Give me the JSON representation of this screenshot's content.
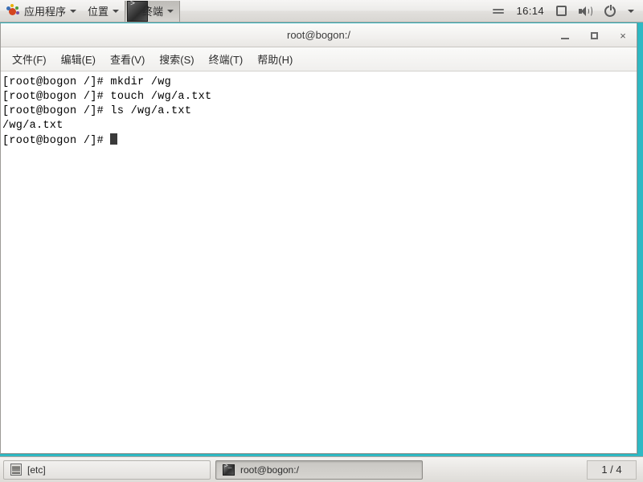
{
  "top_panel": {
    "logo_icon": "gnome-foot-icon",
    "menus": [
      {
        "label": "应用程序",
        "icon": "gnome-foot-icon",
        "active": false
      },
      {
        "label": "位置",
        "active": false
      },
      {
        "label": "终端",
        "active": true,
        "icon": "terminal-icon"
      }
    ],
    "tray": {
      "lines_icon": "menu-lines-icon",
      "clock": "16:14",
      "screen_icon": "display-icon",
      "volume_icon": "volume-icon",
      "power_icon": "power-icon",
      "dropdown_icon": "chevron-down-icon"
    }
  },
  "window": {
    "title": "root@bogon:/",
    "buttons": {
      "minimize": "minimize-button",
      "maximize": "maximize-button",
      "close": "×"
    },
    "menubar": [
      {
        "label": "文件(F)"
      },
      {
        "label": "编辑(E)"
      },
      {
        "label": "查看(V)"
      },
      {
        "label": "搜索(S)"
      },
      {
        "label": "终端(T)"
      },
      {
        "label": "帮助(H)"
      }
    ]
  },
  "terminal": {
    "background": "#ffffff",
    "foreground": "#000000",
    "cursor_color": "#3a3a3a",
    "lines": [
      "[root@bogon /]# mkdir /wg",
      "[root@bogon /]# touch /wg/a.txt",
      "[root@bogon /]# ls /wg/a.txt",
      "/wg/a.txt"
    ],
    "prompt": "[root@bogon /]# "
  },
  "bottom_panel": {
    "tasks": [
      {
        "label": "[etc]",
        "icon": "drawer-icon",
        "active": false
      },
      {
        "label": "root@bogon:/",
        "icon": "terminal-icon",
        "active": true
      }
    ],
    "workspace": "1 / 4"
  }
}
